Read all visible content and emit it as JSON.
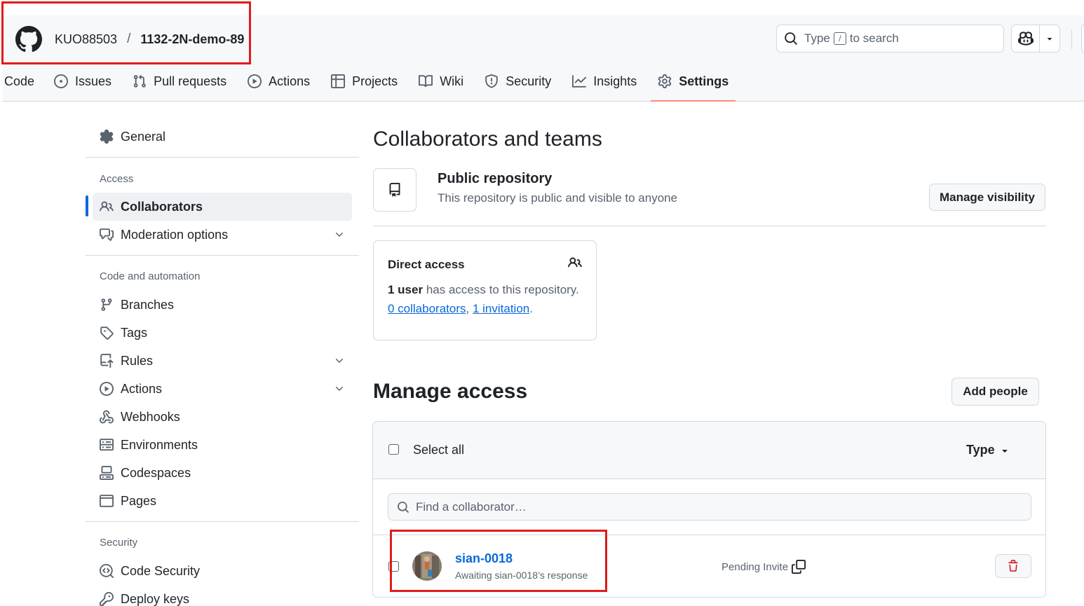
{
  "header": {
    "owner": "KUO88503",
    "separator": "/",
    "repo": "1132-2N-demo-89",
    "search": {
      "prefix": "Type",
      "key": "/",
      "suffix": "to search"
    }
  },
  "nav": {
    "tabs": [
      {
        "label": "Code",
        "icon": "code-icon"
      },
      {
        "label": "Issues",
        "icon": "issue-opened-icon"
      },
      {
        "label": "Pull requests",
        "icon": "git-pull-request-icon"
      },
      {
        "label": "Actions",
        "icon": "play-icon"
      },
      {
        "label": "Projects",
        "icon": "table-icon"
      },
      {
        "label": "Wiki",
        "icon": "book-icon"
      },
      {
        "label": "Security",
        "icon": "shield-icon"
      },
      {
        "label": "Insights",
        "icon": "graph-icon"
      },
      {
        "label": "Settings",
        "icon": "gear-icon",
        "active": true
      }
    ]
  },
  "sidebar": {
    "general": "General",
    "access_heading": "Access",
    "collaborators": "Collaborators",
    "moderation": "Moderation options",
    "code_heading": "Code and automation",
    "branches": "Branches",
    "tags": "Tags",
    "rules": "Rules",
    "actions": "Actions",
    "webhooks": "Webhooks",
    "environments": "Environments",
    "codespaces": "Codespaces",
    "pages": "Pages",
    "security_heading": "Security",
    "code_security": "Code Security",
    "deploy_keys": "Deploy keys"
  },
  "main": {
    "title": "Collaborators and teams",
    "visibility": {
      "title": "Public repository",
      "description": "This repository is public and visible to anyone",
      "button": "Manage visibility"
    },
    "direct_access": {
      "title": "Direct access",
      "user_count": "1 user",
      "user_text": "has access to this repository.",
      "collaborators_link": "0 collaborators",
      "invitation_link": "1 invitation"
    },
    "manage_access": {
      "title": "Manage access",
      "add_button": "Add people",
      "select_all": "Select all",
      "type_filter": "Type",
      "find_placeholder": "Find a collaborator…",
      "rows": [
        {
          "username": "sian-0018",
          "subtitle": "Awaiting sian-0018’s response",
          "status": "Pending Invite"
        }
      ]
    }
  },
  "colors": {
    "accent": "#0969da",
    "active_tab_underline": "#fd8c73",
    "danger": "#d1242f",
    "annotation": "#e01b1b"
  }
}
